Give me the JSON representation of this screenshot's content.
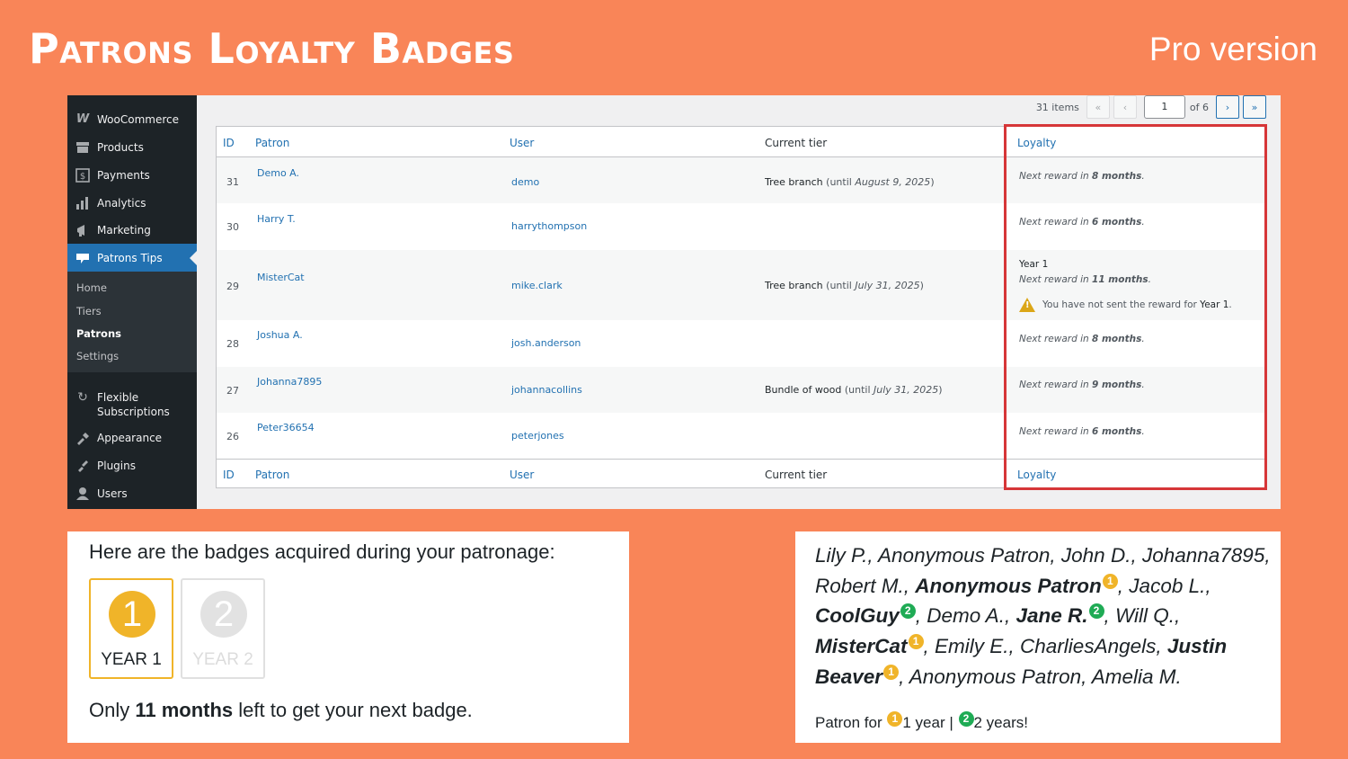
{
  "hero": {
    "title": "Patrons Loyalty Badges",
    "pro": "Pro version"
  },
  "sidebar": {
    "items": [
      {
        "label": "WooCommerce",
        "icon": "woocommerce-icon"
      },
      {
        "label": "Products",
        "icon": "products-icon"
      },
      {
        "label": "Payments",
        "icon": "payments-icon"
      },
      {
        "label": "Analytics",
        "icon": "analytics-icon"
      },
      {
        "label": "Marketing",
        "icon": "marketing-icon"
      },
      {
        "label": "Patrons Tips",
        "icon": "patrons-tips-icon"
      }
    ],
    "sub": [
      "Home",
      "Tiers",
      "Patrons",
      "Settings"
    ],
    "items2": [
      {
        "label": "Flexible\nSubscriptions",
        "icon": "subscriptions-icon"
      },
      {
        "label": "Appearance",
        "icon": "appearance-icon"
      },
      {
        "label": "Plugins",
        "icon": "plugins-icon"
      },
      {
        "label": "Users",
        "icon": "users-icon"
      }
    ]
  },
  "pagination": {
    "items": "31 items",
    "first": "«",
    "prev": "‹",
    "page": "1",
    "of": "of 6",
    "next": "›",
    "last": "»"
  },
  "table": {
    "headers": {
      "id": "ID",
      "patron": "Patron",
      "user": "User",
      "tier": "Current tier",
      "loyalty": "Loyalty"
    },
    "rows": [
      {
        "id": "31",
        "patron": "Demo A.",
        "user": "demo",
        "tier_name": "Tree branch",
        "tier_pre": "(until ",
        "tier_date": "August 9, 2025",
        "tier_post": ")",
        "loy_pre": "Next reward in ",
        "loy_val": "8 months",
        "loy_post": "."
      },
      {
        "id": "30",
        "patron": "Harry T.",
        "user": "harrythompson",
        "loy_pre": "Next reward in ",
        "loy_val": "6 months",
        "loy_post": "."
      },
      {
        "id": "29",
        "patron": "MisterCat",
        "user": "mike.clark",
        "tier_name": "Tree branch",
        "tier_pre": "(until ",
        "tier_date": "July 31, 2025",
        "tier_post": ")",
        "year": "Year 1",
        "loy_pre": "Next reward in ",
        "loy_val": "11 months",
        "loy_post": ".",
        "warn_pre": "You have not sent the reward for ",
        "warn_year": "Year 1",
        "warn_post": "."
      },
      {
        "id": "28",
        "patron": "Joshua A.",
        "user": "josh.anderson",
        "loy_pre": "Next reward in ",
        "loy_val": "8 months",
        "loy_post": "."
      },
      {
        "id": "27",
        "patron": "Johanna7895",
        "user": "johannacollins",
        "tier_name": "Bundle of wood",
        "tier_pre": "(until ",
        "tier_date": "July 31, 2025",
        "tier_post": ")",
        "loy_pre": "Next reward in ",
        "loy_val": "9 months",
        "loy_post": "."
      },
      {
        "id": "26",
        "patron": "Peter36654",
        "user": "peterjones",
        "loy_pre": "Next reward in ",
        "loy_val": "6 months",
        "loy_post": "."
      }
    ]
  },
  "badges_card": {
    "title": "Here are the badges acquired during your patronage:",
    "badge1": {
      "num": "1",
      "label": "YEAR 1"
    },
    "badge2": {
      "num": "2",
      "label": "YEAR 2"
    },
    "foot_pre": "Only ",
    "foot_bold": "11 months",
    "foot_post": " left to get your next badge."
  },
  "names_card": {
    "t1": "Lily P., Anonymous Patron, John D., Johanna7895, Robert M., ",
    "b1": "Anonymous Patron",
    "t2": ", Jacob L., ",
    "b2": "CoolGuy",
    "t3": ", Demo A., ",
    "b3": "Jane R.",
    "t4": ", Will Q., ",
    "b4": "MisterCat",
    "t5": ", Emily E., CharliesAngels, ",
    "b5": "Justin Beaver",
    "t6": ", Anonymous Patron, Amelia M.",
    "one": "1",
    "two": "2",
    "patron_for": "Patron for ",
    "one_year": "1 year | ",
    "two_years": "2 years!"
  },
  "colors": {
    "background": "#F98558",
    "wp_blue": "#2271b1",
    "sidebar": "#1d2327",
    "highlight": "#d63638",
    "badge_gold": "#f0b429",
    "badge_green": "#1fab55"
  }
}
